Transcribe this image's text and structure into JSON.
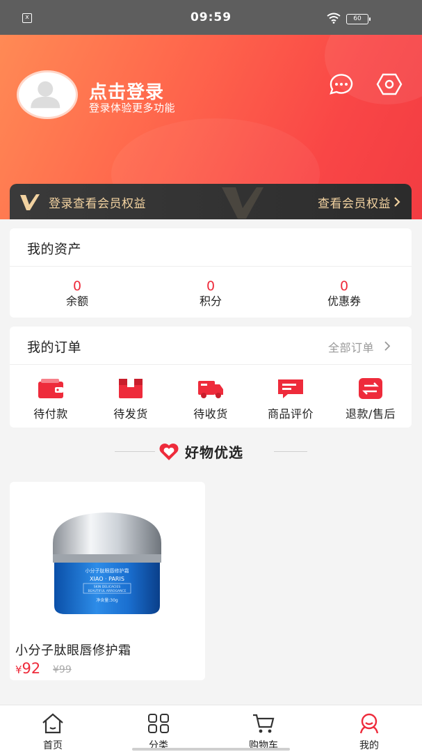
{
  "status_bar": {
    "time": "09:59",
    "battery": "60",
    "left_icon": "x"
  },
  "header": {
    "login_title": "点击登录",
    "login_subtitle": "登录体验更多功能"
  },
  "member": {
    "text": "登录查看会员权益",
    "link": "查看会员权益"
  },
  "assets": {
    "title": "我的资产",
    "items": [
      {
        "value": "0",
        "label": "余额"
      },
      {
        "value": "0",
        "label": "积分"
      },
      {
        "value": "0",
        "label": "优惠券"
      }
    ]
  },
  "orders": {
    "title": "我的订单",
    "all_label": "全部订单",
    "items": [
      {
        "label": "待付款",
        "icon": "wallet-icon"
      },
      {
        "label": "待发货",
        "icon": "package-icon"
      },
      {
        "label": "待收货",
        "icon": "truck-icon"
      },
      {
        "label": "商品评价",
        "icon": "review-icon"
      },
      {
        "label": "退款/售后",
        "icon": "refund-icon"
      }
    ]
  },
  "recommend": {
    "title": "好物优选",
    "products": [
      {
        "name": "小分子肽眼唇修护霜",
        "price_symbol": "¥",
        "price": "92",
        "old_price": "¥99",
        "jar_text": "小分子肽眼唇修护霜",
        "jar_brand": "XIAO · PARIS",
        "jar_line1": "SKIN  DELICACIES",
        "jar_line2": "BEAUTIFUL  ARROGANCE",
        "jar_weight": "净含量:30g"
      }
    ]
  },
  "tabs": [
    {
      "label": "首页",
      "icon": "home-icon"
    },
    {
      "label": "分类",
      "icon": "category-icon"
    },
    {
      "label": "购物车",
      "icon": "cart-icon"
    },
    {
      "label": "我的",
      "icon": "profile-icon",
      "active": true
    }
  ],
  "colors": {
    "accent": "#ee2b3b",
    "header_gradient_start": "#ff8a55",
    "header_gradient_end": "#f23c42",
    "member_gold": "#f2d2a0",
    "member_bg": "#2c2c2c"
  }
}
